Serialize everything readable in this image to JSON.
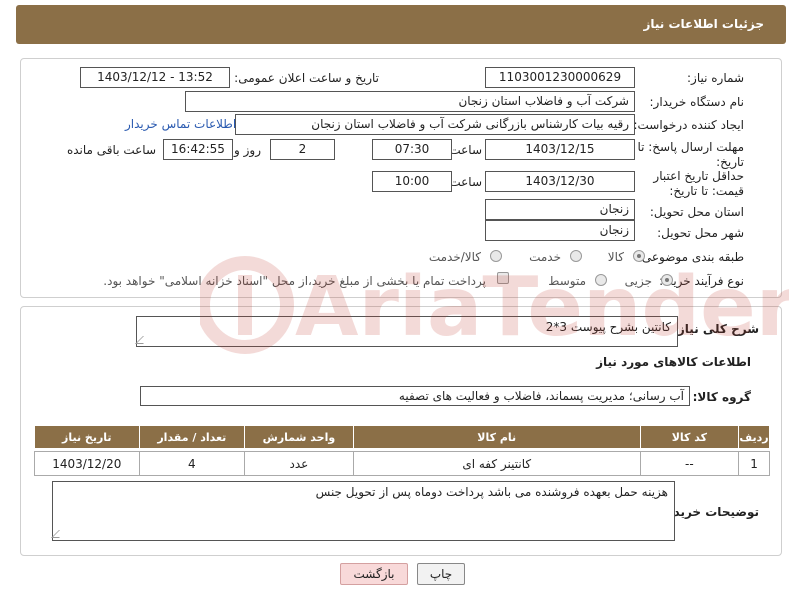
{
  "header": {
    "title": "جزئیات اطلاعات نیاز"
  },
  "form": {
    "need_number_label": "شماره نیاز:",
    "need_number": "1103001230000629",
    "announce_label": "تاریخ و ساعت اعلان عمومی:",
    "announce_value": "1403/12/12 - 13:52",
    "buyer_org_label": "نام دستگاه خریدار:",
    "buyer_org": "شرکت آب و فاضلاب استان زنجان",
    "requester_label": "ایجاد کننده درخواست:",
    "requester": "رقیه بیات کارشناس بازرگانی شرکت آب و فاضلاب استان زنجان",
    "contact_link": "اطلاعات تماس خریدار",
    "reply_deadline_label": "مهلت ارسال پاسخ: تا تاریخ:",
    "reply_date": "1403/12/15",
    "time_label": "ساعت",
    "reply_time": "07:30",
    "days_value": "2",
    "days_label": "روز و",
    "remaining_time": "16:42:55",
    "remaining_label": "ساعت باقی مانده",
    "price_validity_label": "حداقل تاریخ اعتبار قیمت: تا تاریخ:",
    "price_date": "1403/12/30",
    "price_time": "10:00",
    "province_label": "استان محل تحویل:",
    "province": "زنجان",
    "city_label": "شهر محل تحویل:",
    "city": "زنجان",
    "category_label": "طبقه بندی موضوعی:",
    "category_options": [
      "کالا",
      "خدمت",
      "کالا/خدمت"
    ],
    "process_label": "نوع فرآیند خرید :",
    "process_options": [
      "جزیی",
      "متوسط"
    ],
    "payment_note": "پرداخت تمام یا بخشی از مبلغ خرید،از محل \"اسناد خزانه اسلامی\" خواهد بود."
  },
  "summary": {
    "description_label": "شرح کلی نیاز:",
    "description": "کانتین بشرح پیوست 3*2",
    "goods_info_title": "اطلاعات کالاهای مورد نیاز",
    "group_label": "گروه کالا:",
    "group_value": "آب رسانی؛ مدیریت پسماند، فاضلاب و فعالیت های تصفیه"
  },
  "table": {
    "headers": [
      "ردیف",
      "کد کالا",
      "نام کالا",
      "واحد شمارش",
      "تعداد / مقدار",
      "تاریخ نیاز"
    ],
    "rows": [
      [
        "1",
        "--",
        "کانتینر کفه ای",
        "عدد",
        "4",
        "1403/12/20"
      ]
    ]
  },
  "notes": {
    "label": "توضیحات خریدار:",
    "text": "هزینه حمل بعهده فروشنده می باشد پرداخت دوماه پس از تحویل جنس"
  },
  "buttons": {
    "print": "چاپ",
    "back": "بازگشت"
  },
  "watermark": {
    "text": "AriaTender.neT"
  }
}
